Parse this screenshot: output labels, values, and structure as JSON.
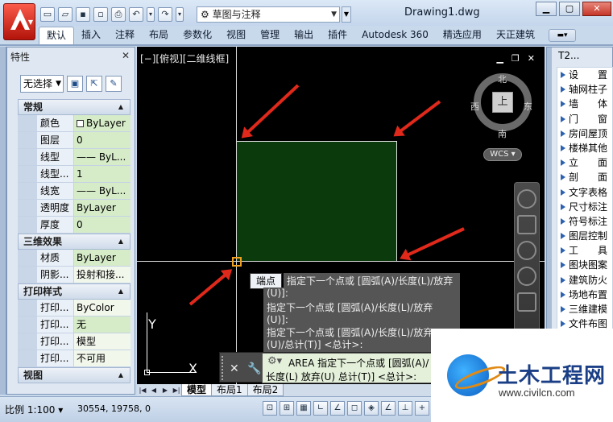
{
  "titlebar": {
    "workspace": "草图与注释",
    "doc_title": "Drawing1.dwg"
  },
  "ribbon_tabs": [
    "默认",
    "插入",
    "注释",
    "布局",
    "参数化",
    "视图",
    "管理",
    "输出",
    "插件",
    "Autodesk 360",
    "精选应用",
    "天正建筑"
  ],
  "properties": {
    "title": "特性",
    "selection": "无选择",
    "sections": [
      {
        "name": "常规",
        "rows": [
          {
            "name": "颜色",
            "value": "ByLayer",
            "hl": true,
            "swatch": true
          },
          {
            "name": "图层",
            "value": "0",
            "hl": true
          },
          {
            "name": "线型",
            "value": "—— ByL...",
            "hl": true
          },
          {
            "name": "线型...",
            "value": "1",
            "hl": true
          },
          {
            "name": "线宽",
            "value": "—— ByL...",
            "hl": true
          },
          {
            "name": "透明度",
            "value": "ByLayer",
            "hl": true
          },
          {
            "name": "厚度",
            "value": "0",
            "hl": true
          }
        ]
      },
      {
        "name": "三维效果",
        "rows": [
          {
            "name": "材质",
            "value": "ByLayer",
            "hl": true
          },
          {
            "name": "阴影...",
            "value": "投射和接...",
            "hl": false
          }
        ]
      },
      {
        "name": "打印样式",
        "rows": [
          {
            "name": "打印...",
            "value": "ByColor",
            "hl": false
          },
          {
            "name": "打印...",
            "value": "无",
            "hl": true
          },
          {
            "name": "打印...",
            "value": "模型",
            "hl": false
          },
          {
            "name": "打印...",
            "value": "不可用",
            "hl": false
          }
        ]
      },
      {
        "name": "视图",
        "rows": []
      }
    ]
  },
  "viewport": {
    "label": "[−][俯视][二维线框]",
    "tooltip": "端点",
    "viewcube": {
      "top": "上",
      "north": "北",
      "south": "南",
      "east": "东",
      "west": "西"
    },
    "wcs": "WCS",
    "ucs_x": "X",
    "ucs_y": "Y"
  },
  "command_history": [
    "指定下一个点或 [圆弧(A)/长度(L)/放弃",
    "(U)]:",
    "指定下一个点或 [圆弧(A)/长度(L)/放弃",
    "(U)]:",
    "指定下一个点或 [圆弧(A)/长度(L)/放弃",
    "(U)/总计(T)] <总计>:"
  ],
  "command_input": {
    "line1": "AREA 指定下一个点或 [圆弧(A)/",
    "line2": "长度(L) 放弃(U) 总计(T)] <总计>:"
  },
  "layout_tabs": [
    "模型",
    "布局1",
    "布局2"
  ],
  "status": {
    "scale": "比例 1:100",
    "coords": "30554, 19758, 0"
  },
  "tool_palette": {
    "title": "T2...",
    "items": [
      "设　　置",
      "轴网柱子",
      "墙　　体",
      "门　　窗",
      "房间屋顶",
      "楼梯其他",
      "立　　面",
      "剖　　面",
      "文字表格",
      "尺寸标注",
      "符号标注",
      "图层控制",
      "工　　具",
      "图块图案",
      "建筑防火",
      "场地布置",
      "三维建模",
      "文件布图"
    ]
  },
  "watermark": {
    "name": "土木工程网",
    "url": "www.civilcn.com"
  }
}
